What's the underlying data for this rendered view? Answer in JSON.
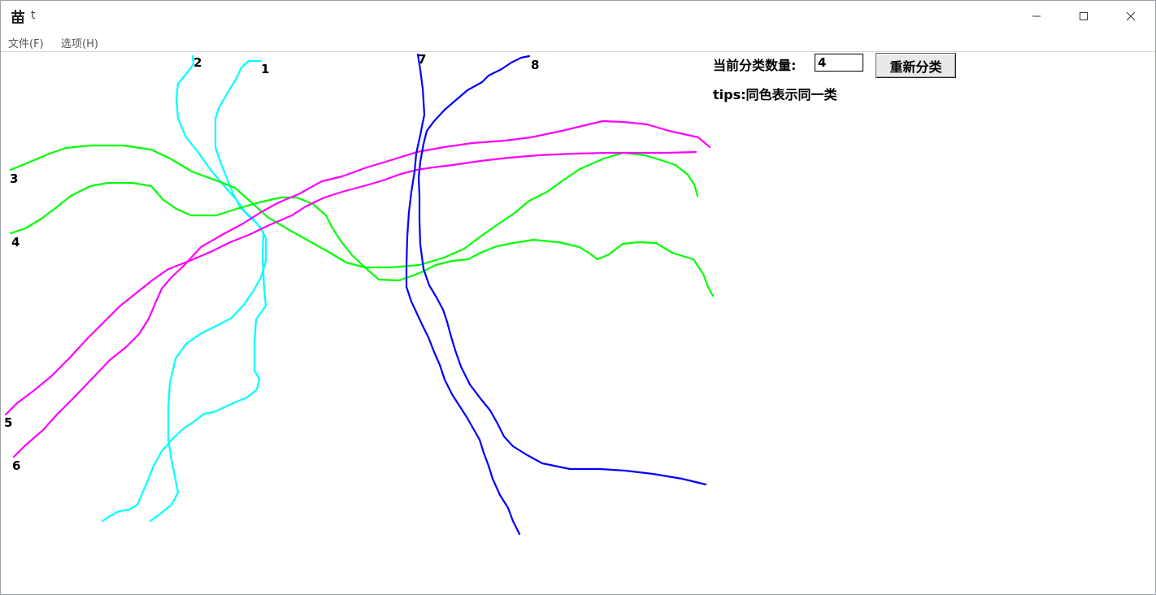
{
  "window": {
    "title": "t",
    "app_icon": "tree-app-icon",
    "buttons": {
      "minimize": "minimize-icon",
      "maximize": "maximize-icon",
      "close": "close-icon"
    }
  },
  "menu": {
    "file_label": "文件(F)",
    "options_label": "选项(H)"
  },
  "controls": {
    "count_label": "当前分类数量:",
    "count_value": "4",
    "reclassify_label": "重新分类",
    "tips": "tips:同色表示同一类"
  },
  "colors": {
    "cyan": "#00FFFF",
    "green": "#00FF00",
    "magenta": "#FF00FF",
    "blue": "#0000FF"
  },
  "tracks": [
    {
      "label": "1",
      "cluster": "cyan"
    },
    {
      "label": "2",
      "cluster": "cyan"
    },
    {
      "label": "3",
      "cluster": "green"
    },
    {
      "label": "4",
      "cluster": "green"
    },
    {
      "label": "5",
      "cluster": "magenta"
    },
    {
      "label": "6",
      "cluster": "magenta"
    },
    {
      "label": "7",
      "cluster": "blue"
    },
    {
      "label": "8",
      "cluster": "blue"
    }
  ]
}
